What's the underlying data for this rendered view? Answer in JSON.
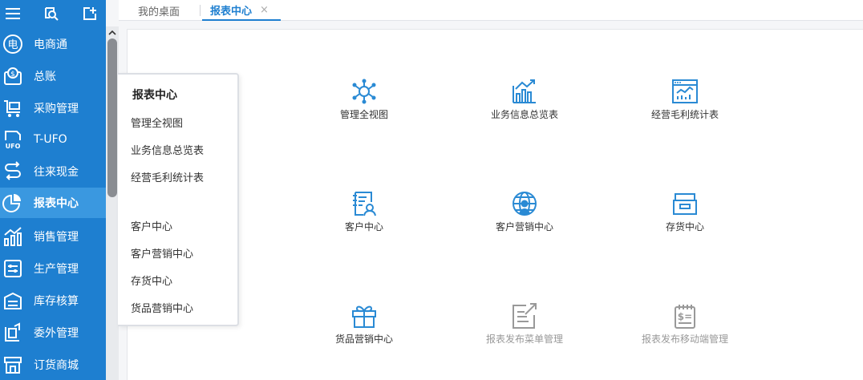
{
  "colors": {
    "sidebar": "#1e7fd0",
    "active": "#3a98e0",
    "accent": "#1e7fd0",
    "icon": "#2a8ad4",
    "disabled_icon": "#999999"
  },
  "toolbar": {
    "icons": [
      "menu-icon",
      "search-icon",
      "add-icon"
    ]
  },
  "sidebar": {
    "items": [
      {
        "label": "电商通",
        "icon": "ecommerce-icon"
      },
      {
        "label": "总账",
        "icon": "ledger-icon"
      },
      {
        "label": "采购管理",
        "icon": "cart-icon"
      },
      {
        "label": "T-UFO",
        "icon": "ufo-icon"
      },
      {
        "label": "往来现金",
        "icon": "transfer-icon"
      },
      {
        "label": "报表中心",
        "icon": "pie-chart-icon",
        "active": true
      },
      {
        "label": "销售管理",
        "icon": "sales-chart-icon"
      },
      {
        "label": "生产管理",
        "icon": "production-icon"
      },
      {
        "label": "库存核算",
        "icon": "inventory-icon"
      },
      {
        "label": "委外管理",
        "icon": "outsource-icon"
      },
      {
        "label": "订货商城",
        "icon": "store-icon"
      }
    ]
  },
  "tabs": {
    "home": "我的桌面",
    "active": "报表中心",
    "close": "×"
  },
  "popup": {
    "title": "报表中心",
    "items": [
      "管理全视图",
      "业务信息总览表",
      "经营毛利统计表",
      "客户中心",
      "客户营销中心",
      "存货中心",
      "货品营销中心"
    ]
  },
  "tiles": [
    {
      "label": "管理全视图",
      "icon": "network-icon"
    },
    {
      "label": "业务信息总览表",
      "icon": "business-chart-icon"
    },
    {
      "label": "经营毛利统计表",
      "icon": "statistics-icon"
    },
    {
      "label": "客户中心",
      "icon": "customer-icon"
    },
    {
      "label": "客户营销中心",
      "icon": "globe-user-icon"
    },
    {
      "label": "存货中心",
      "icon": "box-icon"
    },
    {
      "label": "货品营销中心",
      "icon": "gift-icon"
    },
    {
      "label": "报表发布菜单管理",
      "icon": "publish-icon",
      "disabled": true
    },
    {
      "label": "报表发布移动端管理",
      "icon": "mobile-publish-icon",
      "disabled": true
    }
  ]
}
